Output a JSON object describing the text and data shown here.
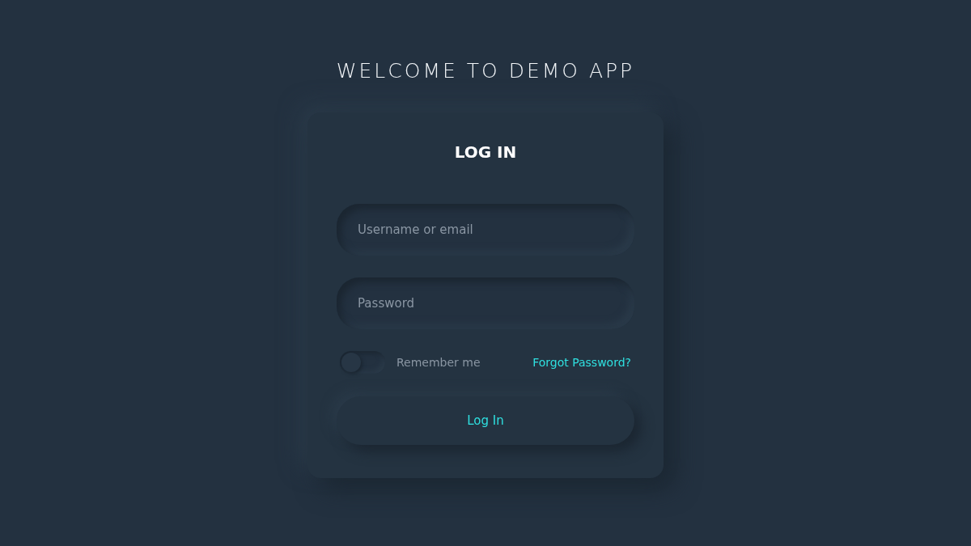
{
  "page_title": "WELCOME TO DEMO APP",
  "card": {
    "title": "LOG IN",
    "fields": [
      {
        "placeholder": "Username or email"
      },
      {
        "placeholder": "Password"
      }
    ],
    "remember": {
      "label": "Remember me",
      "on": false
    },
    "forgot_link": "Forgot Password?",
    "submit": "Log In"
  }
}
